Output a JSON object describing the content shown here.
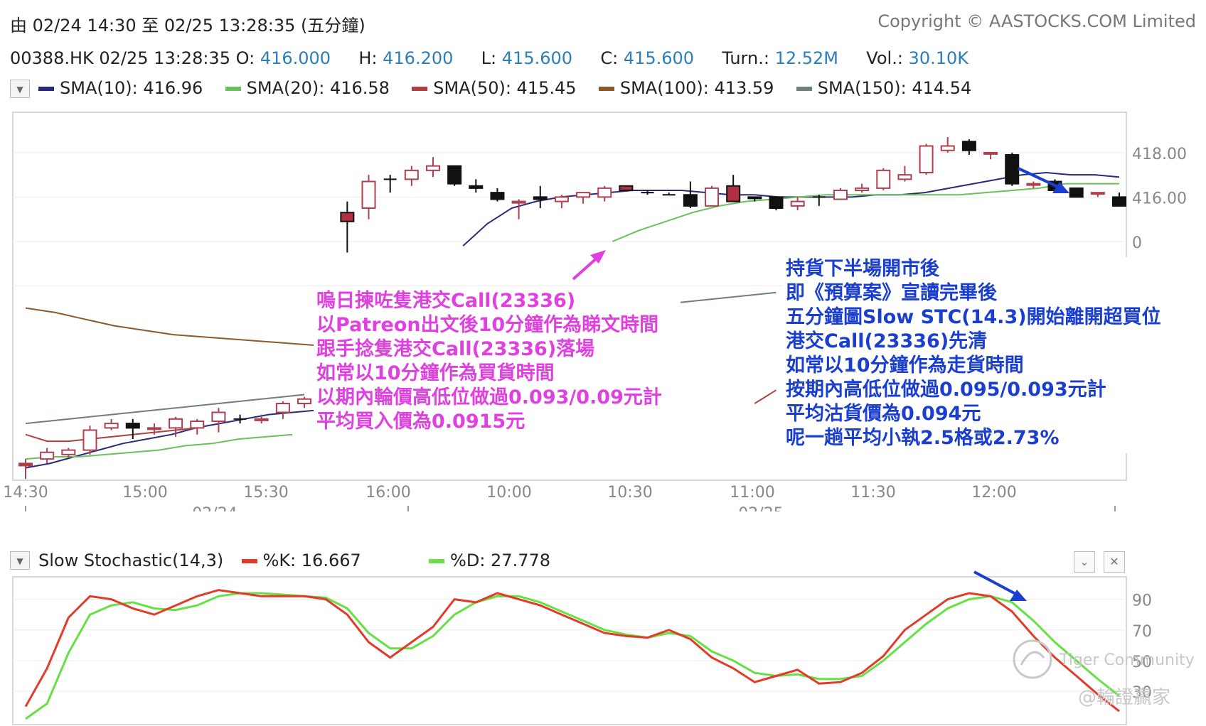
{
  "header": {
    "range": "由  02/24 14:30 至  02/25 13:28:35 (五分鐘)",
    "copyright": "Copyright © AASTOCKS.COM Limited"
  },
  "quote": {
    "symbol_time": "00388.HK 02/25 13:28:35",
    "o_label": "O:",
    "o": "416.000",
    "h_label": "H:",
    "h": "416.200",
    "l_label": "L:",
    "l": "415.600",
    "c_label": "C:",
    "c": "415.600",
    "turn_label": "Turn.:",
    "turn": "12.52M",
    "vol_label": "Vol.:",
    "vol": "30.10K"
  },
  "sma_legend": [
    {
      "label": "SMA(10): 416.96",
      "color": "#2b2a7a"
    },
    {
      "label": "SMA(20): 416.58",
      "color": "#6cc05c"
    },
    {
      "label": "SMA(50): 415.45",
      "color": "#b04040"
    },
    {
      "label": "SMA(100): 413.59",
      "color": "#8a5a2a"
    },
    {
      "label": "SMA(150): 414.54",
      "color": "#6f7f7a"
    }
  ],
  "stoch_legend": {
    "title": "Slow Stochastic(14,3)",
    "k_label": "%K: 16.667",
    "k_color": "#e23b2a",
    "d_label": "%D: 27.778",
    "d_color": "#66e044"
  },
  "annotations": {
    "left": {
      "color": "#e040e0",
      "lines": [
        "嗚日揀咗隻港交Call(23336)",
        "以Patreon出文後10分鐘作為睇文時間",
        "跟手捻隻港交Call(23336)落場",
        "如常以10分鐘作為買貨時間",
        "以期內輪價高低位做過0.093/0.09元計",
        "平均買入價為0.0915元"
      ]
    },
    "right": {
      "color": "#1a3fd0",
      "lines": [
        "持貨下半場開市後",
        "即《預算案》宣讀完畢後",
        "五分鐘圖Slow STC(14.3)開始離開超買位",
        "港交Call(23336)先清",
        "如常以10分鐘作為走貨時間",
        "按期內高低位做過0.095/0.093元計",
        "平均沽貨價為0.094元",
        "呢一趟平均小執2.5格或2.73%"
      ]
    }
  },
  "watermark": {
    "text1": "Tiger Community",
    "text2": "@輪證贏家"
  },
  "chart_data": [
    {
      "type": "candlestick",
      "title": "",
      "y_ticks": [
        "418.00",
        "416.00",
        "0",
        "0"
      ],
      "x_ticks": [
        "14:30",
        "15:00",
        "15:30",
        "16:00",
        "10:00",
        "10:30",
        "11:00",
        "11:30",
        "12:00"
      ],
      "date_labels": [
        "02/24",
        "02/25"
      ],
      "ylim": [
        403.5,
        419.5
      ],
      "ohlc": [
        [
          404.0,
          404.2,
          403.3,
          403.9,
          "up"
        ],
        [
          404.2,
          404.7,
          404.0,
          404.5,
          "up"
        ],
        [
          404.4,
          404.7,
          404.3,
          404.6,
          "up"
        ],
        [
          404.6,
          405.7,
          404.4,
          405.5,
          "up"
        ],
        [
          405.6,
          406.0,
          405.5,
          405.8,
          "up"
        ],
        [
          405.8,
          406.0,
          405.1,
          405.6,
          "down"
        ],
        [
          405.6,
          405.8,
          405.3,
          405.6,
          "up"
        ],
        [
          405.6,
          406.1,
          405.2,
          406.0,
          "up"
        ],
        [
          405.6,
          406.0,
          405.3,
          405.9,
          "up"
        ],
        [
          405.9,
          406.5,
          405.4,
          406.3,
          "up"
        ],
        [
          406.0,
          406.2,
          405.8,
          406.0,
          "cross"
        ],
        [
          406.0,
          406.2,
          405.8,
          406.0,
          "up"
        ],
        [
          406.3,
          406.8,
          406.0,
          406.7,
          "up"
        ],
        [
          406.7,
          407.0,
          406.5,
          406.9,
          "up"
        ],
        [
          406.7,
          406.9,
          406.4,
          406.7,
          "cross"
        ],
        [
          415.3,
          415.8,
          413.5,
          414.9,
          "down"
        ],
        [
          415.5,
          417.0,
          415.0,
          416.7,
          "up"
        ],
        [
          416.8,
          417.0,
          416.2,
          416.8,
          "cross"
        ],
        [
          416.8,
          417.4,
          416.5,
          417.2,
          "up"
        ],
        [
          417.2,
          417.8,
          416.9,
          417.4,
          "up"
        ],
        [
          417.4,
          417.4,
          416.5,
          416.6,
          "down"
        ],
        [
          416.5,
          416.8,
          416.2,
          416.4,
          "down"
        ],
        [
          416.2,
          416.4,
          415.8,
          415.9,
          "down"
        ],
        [
          415.8,
          415.9,
          415.0,
          415.8,
          "up"
        ],
        [
          415.9,
          416.5,
          415.5,
          416.0,
          "down"
        ],
        [
          415.8,
          416.1,
          415.5,
          416.0,
          "up"
        ],
        [
          416.0,
          416.2,
          415.7,
          416.2,
          "up"
        ],
        [
          416.0,
          416.5,
          415.8,
          416.4,
          "up"
        ],
        [
          416.5,
          416.5,
          416.3,
          416.3,
          "down"
        ],
        [
          416.2,
          416.3,
          416.1,
          416.2,
          "cross"
        ],
        [
          416.1,
          416.2,
          416.1,
          416.1,
          "cross"
        ],
        [
          416.1,
          416.7,
          415.5,
          415.6,
          "down"
        ],
        [
          415.6,
          416.5,
          415.6,
          416.4,
          "up"
        ],
        [
          416.5,
          417.0,
          415.8,
          415.8,
          "down"
        ],
        [
          416.0,
          416.0,
          415.8,
          416.0,
          "down"
        ],
        [
          416.0,
          416.0,
          415.4,
          415.5,
          "down"
        ],
        [
          415.6,
          416.0,
          415.4,
          415.8,
          "up"
        ],
        [
          415.8,
          416.1,
          415.6,
          416.0,
          "cross"
        ],
        [
          415.9,
          416.4,
          415.9,
          416.3,
          "up"
        ],
        [
          416.3,
          416.6,
          416.2,
          416.4,
          "up"
        ],
        [
          416.4,
          417.3,
          416.3,
          417.2,
          "up"
        ],
        [
          416.8,
          417.4,
          416.7,
          417.0,
          "up"
        ],
        [
          417.1,
          418.4,
          417.0,
          418.3,
          "up"
        ],
        [
          418.1,
          418.7,
          418.0,
          418.3,
          "up"
        ],
        [
          418.5,
          418.6,
          417.9,
          418.1,
          "down"
        ],
        [
          418.0,
          418.0,
          417.7,
          418.0,
          "up"
        ],
        [
          417.9,
          418.0,
          416.5,
          416.6,
          "down"
        ],
        [
          416.6,
          416.7,
          416.4,
          416.6,
          "up"
        ],
        [
          416.7,
          416.8,
          416.3,
          416.3,
          "down"
        ],
        [
          416.4,
          416.4,
          416.0,
          416.0,
          "down"
        ],
        [
          416.2,
          416.2,
          416.0,
          416.2,
          "up"
        ],
        [
          416.0,
          416.2,
          415.6,
          415.6,
          "down"
        ]
      ],
      "series": [
        {
          "name": "SMA(10)",
          "color": "#2b2a7a",
          "values": [
            403.8,
            404.0,
            404.3,
            404.6,
            404.9,
            405.1,
            405.3,
            405.6,
            405.8,
            406.0,
            406.2,
            406.3,
            406.4,
            null,
            null,
            null,
            null,
            null,
            413.8,
            414.8,
            415.5,
            415.8,
            416.0,
            416.1,
            416.2,
            416.3,
            416.3,
            416.3,
            416.2,
            416.1,
            416.1,
            416.0,
            416.0,
            416.0,
            416.0,
            416.1,
            416.1,
            416.2,
            416.4,
            416.6,
            416.8,
            417.0,
            417.1,
            417.0,
            417.0,
            416.9
          ]
        },
        {
          "name": "SMA(20)",
          "color": "#6cc05c",
          "values": [
            404.2,
            404.3,
            404.3,
            404.4,
            404.5,
            404.6,
            404.8,
            404.9,
            405.1,
            405.2,
            405.3,
            null,
            null,
            null,
            null,
            null,
            null,
            null,
            null,
            null,
            null,
            null,
            414.0,
            414.5,
            414.9,
            415.3,
            415.6,
            415.8,
            415.9,
            416.0,
            416.1,
            416.1,
            416.1,
            416.1,
            416.1,
            416.1,
            416.2,
            416.3,
            416.4,
            416.6,
            416.6,
            416.6
          ]
        },
        {
          "name": "SMA(50)",
          "color": "#b04040",
          "values": [
            405.3,
            405.0,
            405.0,
            405.1,
            405.2,
            405.3,
            405.4,
            405.5,
            405.6,
            null,
            null,
            null,
            null,
            null,
            null,
            null,
            null,
            null,
            null,
            null,
            null,
            null,
            null,
            null,
            null,
            null,
            null,
            null,
            null,
            null,
            null,
            null,
            null,
            null,
            406.7,
            407.3,
            null,
            null,
            null,
            null,
            null,
            null,
            null,
            null,
            null,
            null,
            null,
            null,
            null,
            null,
            null,
            415.45
          ]
        },
        {
          "name": "SMA(100)",
          "color": "#8a5a2a",
          "values": [
            411.0,
            410.8,
            410.5,
            410.2,
            410.0,
            409.8,
            409.7,
            409.6,
            409.5,
            409.4,
            409.3,
            409.2,
            409.1,
            409.0,
            null,
            null,
            null,
            null,
            null,
            null,
            null,
            null,
            null,
            null,
            null,
            null,
            null,
            null,
            null,
            null,
            null,
            408.8,
            408.6,
            408.5,
            408.4,
            408.3,
            408.3,
            408.3
          ]
        },
        {
          "name": "SMA(150)",
          "color": "#6f7f7a",
          "values": [
            405.8,
            405.9,
            406.0,
            406.1,
            406.2,
            406.3,
            406.4,
            406.5,
            406.6,
            406.7,
            406.8,
            406.9,
            407.0,
            407.1,
            null,
            null,
            null,
            null,
            null,
            null,
            null,
            null,
            null,
            null,
            null,
            null,
            410.8,
            410.9,
            411.0,
            411.1,
            411.2,
            411.3,
            411.4,
            411.5,
            411.6,
            411.7,
            null,
            null,
            null,
            null,
            null,
            null,
            null,
            null,
            null,
            null,
            null,
            null,
            null,
            null,
            null,
            null
          ]
        }
      ]
    },
    {
      "type": "line",
      "title": "Slow Stochastic(14,3)",
      "y_ticks": [
        "90",
        "70",
        "50",
        "30"
      ],
      "ylim": [
        12,
        100
      ],
      "series": [
        {
          "name": "%K",
          "color": "#e23b2a",
          "values": [
            20,
            45,
            78,
            92,
            90,
            84,
            80,
            86,
            92,
            96,
            94,
            92,
            92,
            92,
            90,
            80,
            62,
            52,
            62,
            72,
            90,
            88,
            94,
            90,
            86,
            80,
            74,
            68,
            66,
            65,
            70,
            64,
            52,
            45,
            36,
            40,
            44,
            35,
            36,
            42,
            53,
            70,
            80,
            90,
            94,
            92,
            82,
            66,
            52,
            40,
            28,
            17
          ]
        },
        {
          "name": "%D",
          "color": "#66e044",
          "values": [
            12,
            22,
            55,
            80,
            86,
            88,
            84,
            83,
            86,
            92,
            94,
            94,
            93,
            92,
            91,
            84,
            68,
            58,
            58,
            66,
            80,
            88,
            92,
            92,
            88,
            82,
            76,
            70,
            67,
            65,
            68,
            66,
            56,
            50,
            42,
            40,
            41,
            38,
            38,
            40,
            50,
            62,
            74,
            84,
            90,
            92,
            88,
            76,
            62,
            50,
            38,
            27
          ]
        }
      ]
    }
  ]
}
